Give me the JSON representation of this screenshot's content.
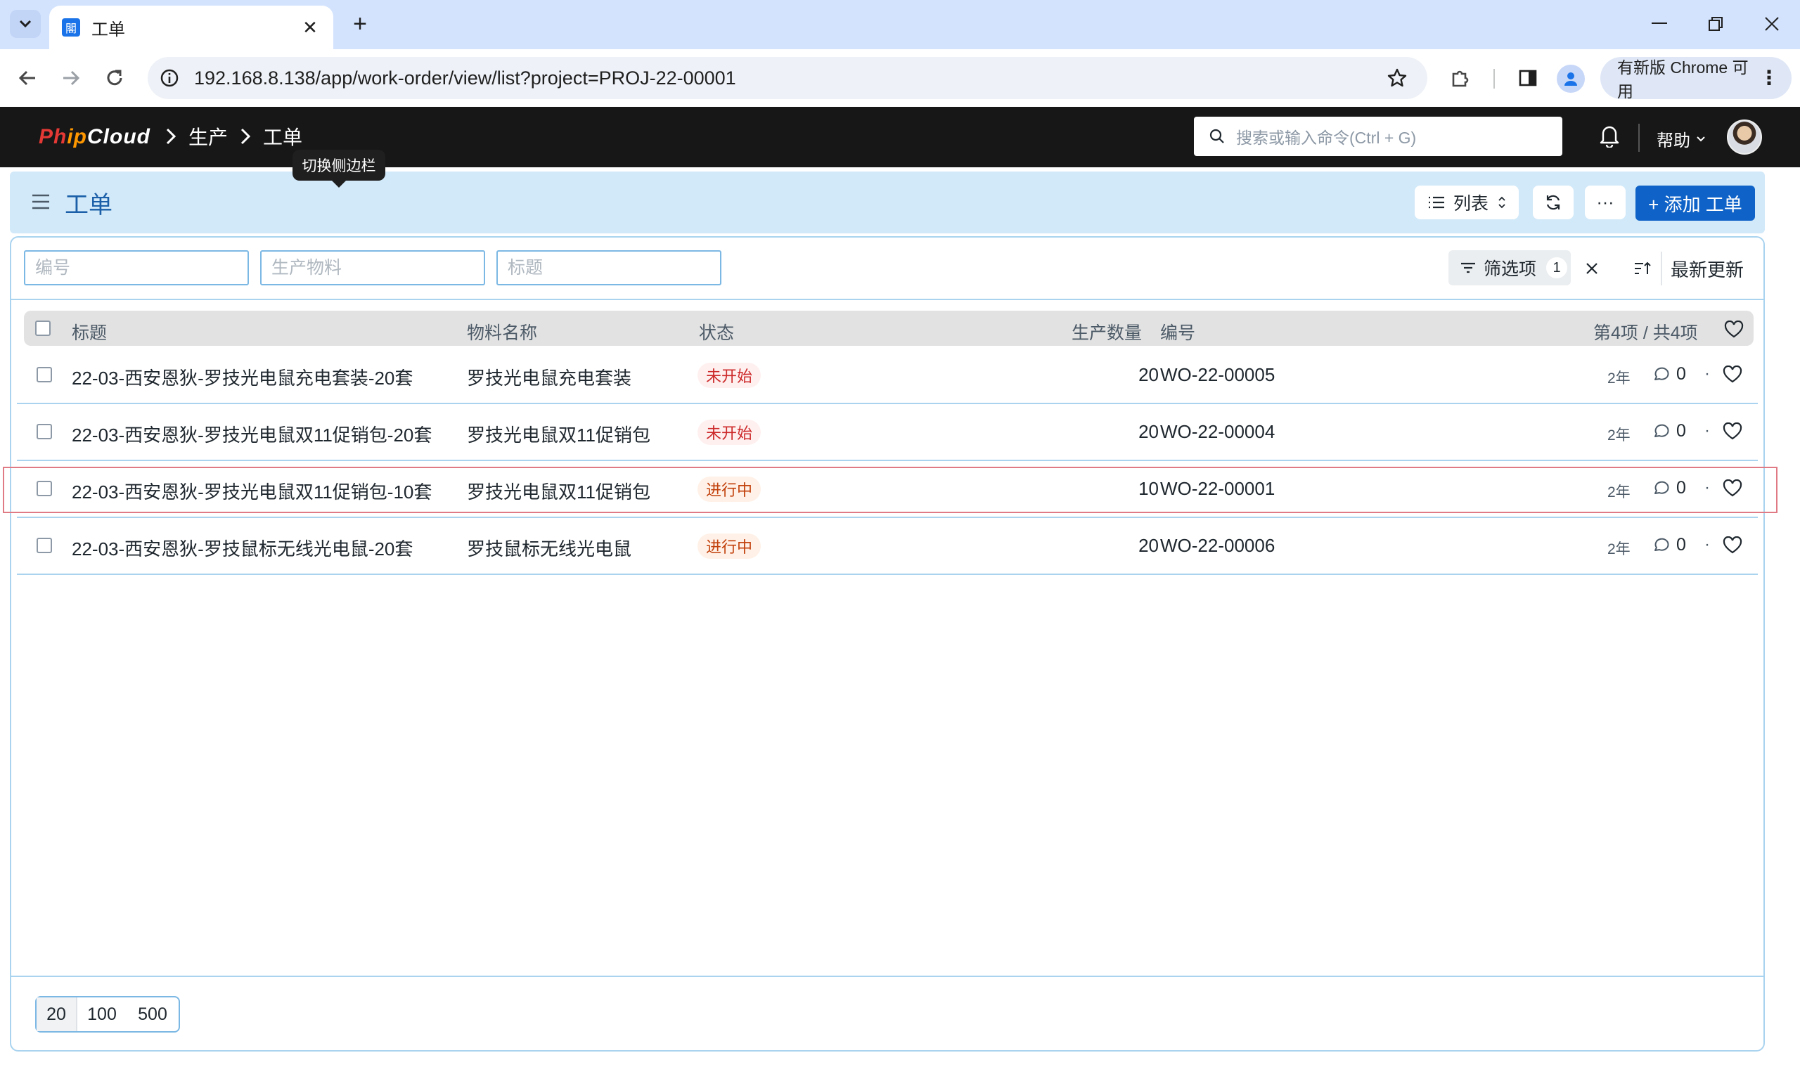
{
  "browser": {
    "tab_title": "工单",
    "tab_favicon": "閣",
    "url": "192.168.8.138/app/work-order/view/list?project=PROJ-22-00001",
    "update_label": "有新版 Chrome 可用"
  },
  "app": {
    "logo": {
      "part1": "Ph",
      "part2": "ip",
      "part3": "Cloud"
    },
    "breadcrumbs": [
      "生产",
      "工单"
    ],
    "search_placeholder": "搜索或输入命令(Ctrl + G)",
    "help_label": "帮助",
    "tooltip": "切换侧边栏"
  },
  "page": {
    "title": "工单",
    "view_label": "列表",
    "more_label": "···",
    "add_label": "+ 添加 工单"
  },
  "filters": {
    "inputs": [
      {
        "placeholder": "编号"
      },
      {
        "placeholder": "生产物料"
      },
      {
        "placeholder": "标题"
      }
    ],
    "filter_label": "筛选项",
    "filter_count": "1",
    "sort_label": "最新更新"
  },
  "table": {
    "headers": {
      "title": "标题",
      "item_name": "物料名称",
      "status": "状态",
      "qty": "生产数量",
      "id": "编号",
      "count": "第4项 / 共4项"
    },
    "rows": [
      {
        "title": "22-03-西安恩狄-罗技光电鼠充电套装-20套",
        "item": "罗技光电鼠充电套装",
        "status": "未开始",
        "status_color": "#cc2929",
        "qty": "20",
        "id": "WO-22-00005",
        "age": "2年",
        "comments": "0"
      },
      {
        "title": "22-03-西安恩狄-罗技光电鼠双11促销包-20套",
        "item": "罗技光电鼠双11促销包",
        "status": "未开始",
        "status_color": "#cc2929",
        "qty": "20",
        "id": "WO-22-00004",
        "age": "2年",
        "comments": "0"
      },
      {
        "title": "22-03-西安恩狄-罗技光电鼠双11促销包-10套",
        "item": "罗技光电鼠双11促销包",
        "status": "进行中",
        "status_color": "#c2410c",
        "qty": "10",
        "id": "WO-22-00001",
        "age": "2年",
        "comments": "0"
      },
      {
        "title": "22-03-西安恩狄-罗技鼠标无线光电鼠-20套",
        "item": "罗技鼠标无线光电鼠",
        "status": "进行中",
        "status_color": "#c2410c",
        "qty": "20",
        "id": "WO-22-00006",
        "age": "2年",
        "comments": "0"
      }
    ]
  },
  "pager": {
    "sizes": [
      "20",
      "100",
      "500"
    ]
  }
}
